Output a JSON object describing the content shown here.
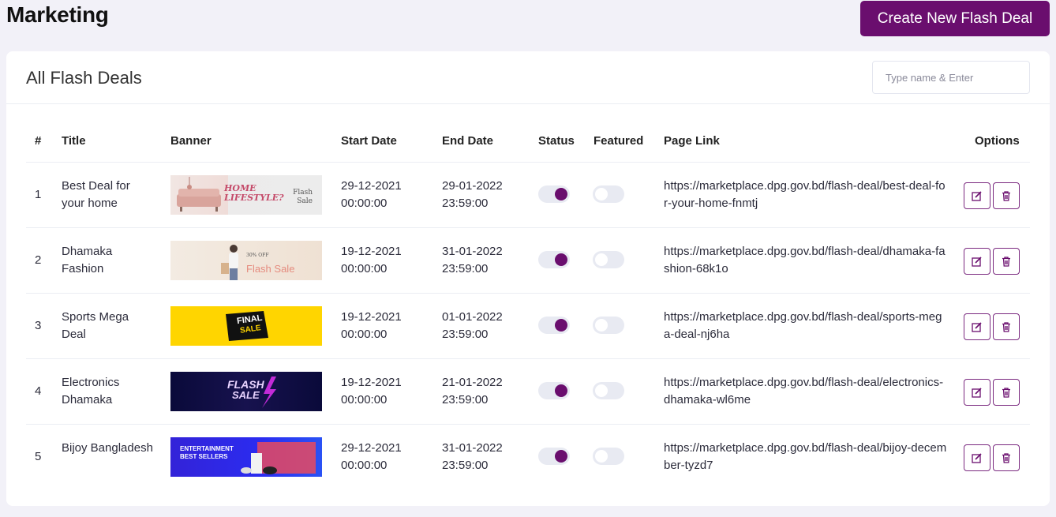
{
  "page": {
    "title": "Marketing",
    "create_button": "Create New Flash Deal"
  },
  "card": {
    "title": "All Flash Deals",
    "search_placeholder": "Type name & Enter"
  },
  "table": {
    "headers": {
      "index": "#",
      "title": "Title",
      "banner": "Banner",
      "start": "Start Date",
      "end": "End Date",
      "status": "Status",
      "featured": "Featured",
      "link": "Page Link",
      "options": "Options"
    },
    "rows": [
      {
        "index": "1",
        "title": "Best Deal for your home",
        "start_date": "29-12-2021",
        "start_time": "00:00:00",
        "end_date": "29-01-2022",
        "end_time": "23:59:00",
        "status": true,
        "featured": false,
        "link": "https://marketplace.dpg.gov.bd/flash-deal/best-deal-for-your-home-fnmtj",
        "banner": {
          "text_a": "HOME LIFESTYLE?",
          "text_b": "Flash Sale"
        }
      },
      {
        "index": "2",
        "title": "Dhamaka Fashion",
        "start_date": "19-12-2021",
        "start_time": "00:00:00",
        "end_date": "31-01-2022",
        "end_time": "23:59:00",
        "status": true,
        "featured": false,
        "link": "https://marketplace.dpg.gov.bd/flash-deal/dhamaka-fashion-68k1o",
        "banner": {
          "text_a": "30% OFF",
          "text_b": "Flash Sale"
        }
      },
      {
        "index": "3",
        "title": "Sports Mega Deal",
        "start_date": "19-12-2021",
        "start_time": "00:00:00",
        "end_date": "01-01-2022",
        "end_time": "23:59:00",
        "status": true,
        "featured": false,
        "link": "https://marketplace.dpg.gov.bd/flash-deal/sports-mega-deal-nj6ha",
        "banner": {
          "text_a": "FINAL",
          "text_b": "SALE"
        }
      },
      {
        "index": "4",
        "title": "Electronics Dhamaka",
        "start_date": "19-12-2021",
        "start_time": "00:00:00",
        "end_date": "21-01-2022",
        "end_time": "23:59:00",
        "status": true,
        "featured": false,
        "link": "https://marketplace.dpg.gov.bd/flash-deal/electronics-dhamaka-wl6me",
        "banner": {
          "text_a": "FLASH",
          "text_b": "SALE"
        }
      },
      {
        "index": "5",
        "title": "Bijoy Bangladesh",
        "start_date": "29-12-2021",
        "start_time": "00:00:00",
        "end_date": "31-01-2022",
        "end_time": "23:59:00",
        "status": true,
        "featured": false,
        "link": "https://marketplace.dpg.gov.bd/flash-deal/bijoy-december-tyzd7",
        "banner": {
          "text_a": "ENTERTAINMENT",
          "text_b": "BEST SELLERS"
        }
      }
    ]
  },
  "colors": {
    "accent": "#6a0e6e",
    "background": "#f2f1f8",
    "toggle_track": "#e8eaf2"
  },
  "icons": {
    "edit": "edit-icon",
    "delete": "trash-icon"
  }
}
